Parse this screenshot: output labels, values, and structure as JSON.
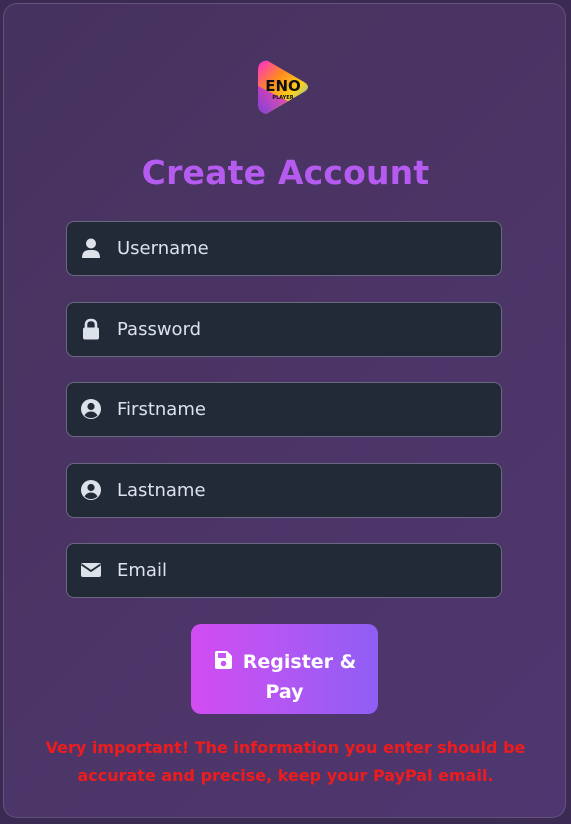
{
  "logo": {
    "text": "ENO",
    "subtext": "PLAYER",
    "icon": "eno-player-logo"
  },
  "title": "Create Account",
  "fields": {
    "username": {
      "placeholder": "Username",
      "value": "",
      "icon": "user-icon"
    },
    "password": {
      "placeholder": "Password",
      "value": "",
      "icon": "lock-icon"
    },
    "firstname": {
      "placeholder": "Firstname",
      "value": "",
      "icon": "user-circle-icon"
    },
    "lastname": {
      "placeholder": "Lastname",
      "value": "",
      "icon": "user-circle-icon"
    },
    "email": {
      "placeholder": "Email",
      "value": "",
      "icon": "envelope-icon"
    }
  },
  "submit": {
    "label": "Register & Pay",
    "icon": "save-icon"
  },
  "warning": "Very important! The information you enter should be accurate and precise, keep your PayPal email.",
  "colors": {
    "title": "#b65bf0",
    "input_bg": "#222a38",
    "warning": "#ee1c1c",
    "button_gradient_start": "#d24cf2",
    "button_gradient_end": "#8f5ef5"
  }
}
